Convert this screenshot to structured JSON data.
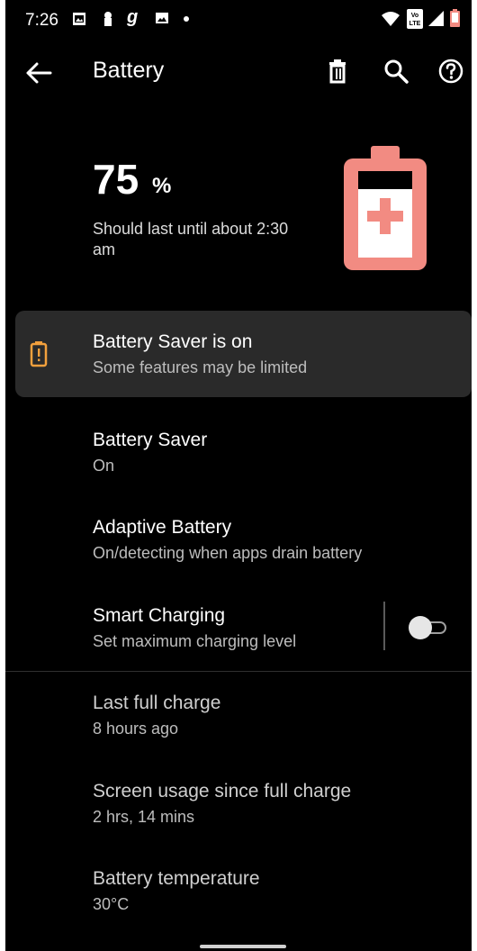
{
  "status_bar": {
    "time": "7:26",
    "icons": [
      "gallery-notification-icon",
      "keyhole-notification-icon",
      "g-notification-icon",
      "image-notification-icon",
      "dot-icon",
      "wifi-icon",
      "volte-icon",
      "signal-icon",
      "battery-low-icon"
    ],
    "volte_label": "Vo LTE"
  },
  "app_bar": {
    "title": "Battery",
    "actions": [
      "trash-icon",
      "search-icon",
      "help-icon"
    ]
  },
  "hero": {
    "percent": "75",
    "percent_unit": "%",
    "estimate": "Should last until about 2:30 am",
    "battery_color": "#f28b82"
  },
  "saver_banner": {
    "title": "Battery Saver is on",
    "subtitle": "Some features may be limited",
    "icon": "battery-alert-icon",
    "icon_color": "#f2a03d"
  },
  "settings": [
    {
      "title": "Battery Saver",
      "subtitle": "On"
    },
    {
      "title": "Adaptive Battery",
      "subtitle": "On/detecting when apps drain battery"
    },
    {
      "title": "Smart Charging",
      "subtitle": "Set maximum charging level",
      "toggle": "off"
    }
  ],
  "info": [
    {
      "title": "Last full charge",
      "subtitle": "8 hours ago"
    },
    {
      "title": "Screen usage since full charge",
      "subtitle": "2 hrs, 14 mins"
    },
    {
      "title": "Battery temperature",
      "subtitle": "30°C"
    }
  ]
}
